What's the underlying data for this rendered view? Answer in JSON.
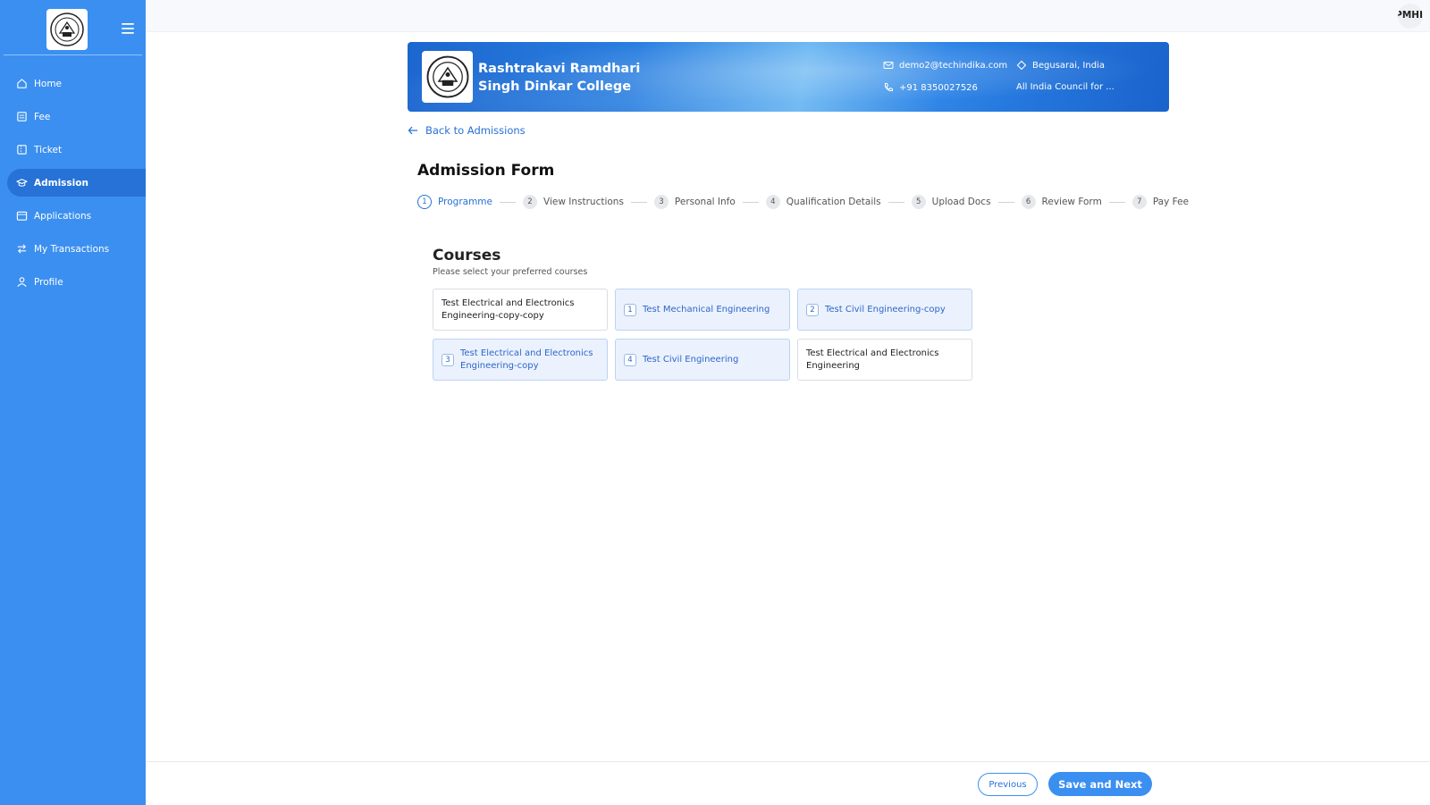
{
  "sidebar": {
    "items": [
      {
        "label": "Home",
        "icon": "home-icon"
      },
      {
        "label": "Fee",
        "icon": "receipt-icon"
      },
      {
        "label": "Ticket",
        "icon": "ticket-icon"
      },
      {
        "label": "Admission",
        "icon": "graduation-cap-icon",
        "active": true
      },
      {
        "label": "Applications",
        "icon": "calendar-icon"
      },
      {
        "label": "My Transactions",
        "icon": "transfer-icon"
      },
      {
        "label": "Profile",
        "icon": "user-icon"
      }
    ]
  },
  "topbar": {
    "avatar_text": "IPMHI"
  },
  "banner": {
    "college_name": "Rashtrakavi Ramdhari Singh Dinkar College",
    "email": "demo2@techindika.com",
    "phone": "+91 8350027526",
    "location": "Begusarai, India",
    "affiliation": "All India Council for ..."
  },
  "back_link": "Back to Admissions",
  "form_title": "Admission Form",
  "steps": [
    {
      "num": "1",
      "label": "Programme",
      "active": true
    },
    {
      "num": "2",
      "label": "View Instructions"
    },
    {
      "num": "3",
      "label": "Personal Info"
    },
    {
      "num": "4",
      "label": "Qualification Details"
    },
    {
      "num": "5",
      "label": "Upload Docs"
    },
    {
      "num": "6",
      "label": "Review Form"
    },
    {
      "num": "7",
      "label": "Pay Fee"
    }
  ],
  "courses": {
    "title": "Courses",
    "subtitle": "Please select your preferred courses",
    "items": [
      {
        "name": "Test Electrical and Electronics Engineering-copy-copy",
        "order": ""
      },
      {
        "name": "Test Mechanical Engineering",
        "order": "1"
      },
      {
        "name": "Test Civil Engineering-copy",
        "order": "2"
      },
      {
        "name": "Test Electrical and Electronics Engineering-copy",
        "order": "3"
      },
      {
        "name": "Test Civil Engineering",
        "order": "4"
      },
      {
        "name": "Test Electrical and Electronics Engineering",
        "order": ""
      }
    ]
  },
  "footer": {
    "previous_label": "Previous",
    "next_label": "Save and Next"
  },
  "colors": {
    "primary": "#3b8ff0",
    "primary_dark": "#2672d6",
    "selected_bg": "#ebf2fd"
  }
}
